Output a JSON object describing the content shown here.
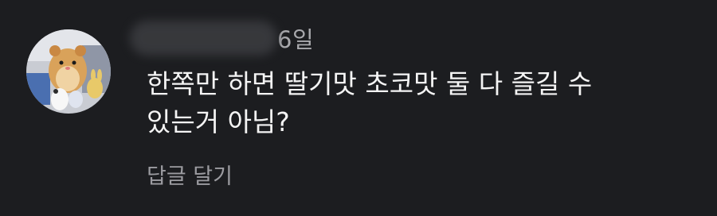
{
  "comment": {
    "timestamp": "6일",
    "text": "한쪽만 하면 딸기맛 초코맛 둘 다 즐길 수\n있는거 아님?",
    "reply_label": "답글 달기",
    "avatar_icon": "hamster-avatar-icon"
  },
  "colors": {
    "background": "#1c1d20",
    "text": "#f4f4f4",
    "muted": "#a9a9ad"
  }
}
